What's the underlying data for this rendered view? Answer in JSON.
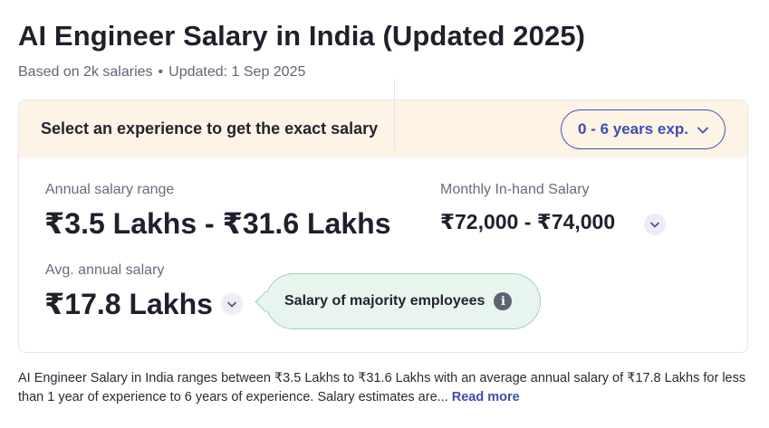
{
  "header": {
    "title": "AI Engineer Salary in India (Updated 2025)",
    "based_on": "Based on 2k salaries",
    "separator": "•",
    "updated": "Updated: 1 Sep 2025"
  },
  "card": {
    "prompt": "Select an experience to get the exact salary",
    "experience_select": {
      "label": "0 - 6 years exp.",
      "icon": "chevron-down-icon"
    },
    "annual_range": {
      "label": "Annual salary range",
      "value": "₹3.5 Lakhs - ₹31.6 Lakhs"
    },
    "monthly": {
      "label": "Monthly In-hand Salary",
      "value": "₹72,000 - ₹74,000"
    },
    "avg": {
      "label": "Avg. annual salary",
      "value": "₹17.8 Lakhs"
    },
    "tooltip": {
      "text": "Salary of majority employees",
      "icon": "info-icon"
    }
  },
  "description": {
    "text": "AI Engineer Salary in India ranges between ₹3.5 Lakhs to ₹31.6 Lakhs with an average annual salary of ₹17.8 Lakhs for less than 1 year of experience to 6 years of experience. Salary estimates are...",
    "read_more": "Read more"
  },
  "colors": {
    "accent": "#3f4db0",
    "banner": "#fdf4e6",
    "tooltip_bg": "#e7f5ee"
  }
}
